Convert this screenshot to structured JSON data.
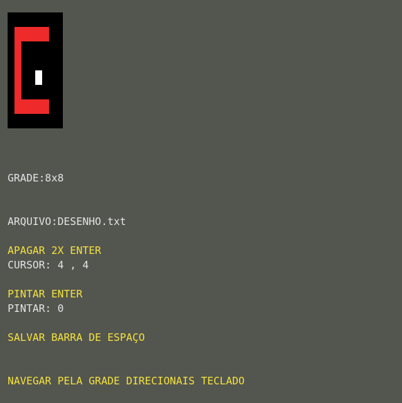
{
  "colors": {
    "background": "#53554f",
    "canvas": "#000000",
    "paint": "#ee2a2a",
    "cursor": "#ffffff",
    "info_text": "#e3e3e3",
    "help_text": "#f2e23e"
  },
  "info": {
    "grade": "GRADE:8x8",
    "arquivo": "ARQUIVO:DESENHO.txt",
    "cursor": "CURSOR: 4 , 4",
    "pintar": "PINTAR: 0"
  },
  "help": {
    "apagar": "APAGAR 2X ENTER",
    "pintar": "PINTAR ENTER",
    "salvar": "SALVAR BARRA DE ESPAÇO",
    "navegar": "NAVEGAR PELA GRADE DIRECIONAIS TECLADO"
  }
}
